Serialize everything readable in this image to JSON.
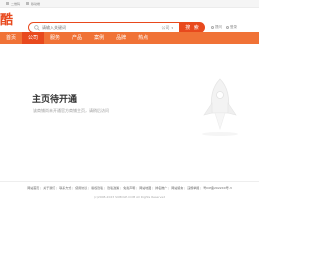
{
  "topbar": {
    "items": [
      "二维码",
      "移动端"
    ]
  },
  "header": {
    "logo_text": "酷乐",
    "search_placeholder": "请输入关键词",
    "search_type": "公司",
    "search_button": "搜 索",
    "links": [
      "提问",
      "登录"
    ]
  },
  "nav": {
    "items": [
      "首页",
      "公司",
      "服务",
      "产品",
      "案例",
      "品牌",
      "热点"
    ],
    "active_index": 1
  },
  "main": {
    "title": "主页待开通",
    "description": "该商铺尚未开通官方商铺主页，请稍后访问"
  },
  "footer": {
    "links": [
      "网站首页",
      "关于我们",
      "联系方式",
      "使用协议",
      "版权隐私",
      "隐私政策",
      "免责声明",
      "网站地图",
      "排名推广",
      "网站留言",
      "违规举报",
      "粤ICP备2022XX号-3"
    ],
    "copyright": "(c)2008-2023 SUBOLE.COM All Rights Reserved"
  },
  "colors": {
    "brand": "#e8491d",
    "nav": "#f07236"
  }
}
